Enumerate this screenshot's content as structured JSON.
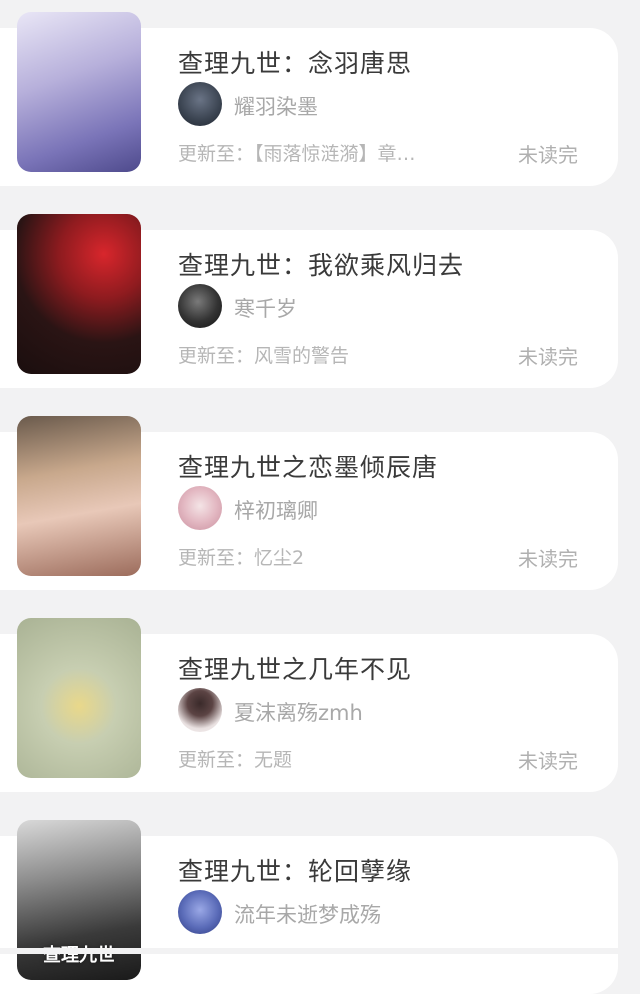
{
  "books": [
    {
      "title": "查理九世：念羽唐思",
      "author": "耀羽染墨",
      "update_prefix": "更新至：",
      "update": "【雨落惊涟漪】章…",
      "status": "未读完",
      "cover_text": "",
      "colors": {
        "cover": "#b9b3dc",
        "avatar": "#3a4350"
      }
    },
    {
      "title": "查理九世：我欲乘风归去",
      "author": "寒千岁",
      "update_prefix": "更新至：",
      "update": "风雪的警告",
      "status": "未读完",
      "cover_text": "",
      "colors": {
        "cover": "#3b1d1d",
        "avatar": "#2a2a2a"
      }
    },
    {
      "title": "查理九世之恋墨倾辰唐",
      "author": "梓初璃卿",
      "update_prefix": "更新至：",
      "update": "忆尘2",
      "status": "未读完",
      "cover_text": "",
      "colors": {
        "cover": "#c9a58f",
        "avatar": "#e6cdd3"
      }
    },
    {
      "title": "查理九世之几年不见",
      "author": "夏沫离殇zmh",
      "update_prefix": "更新至：",
      "update": "无题",
      "status": "未读完",
      "cover_text": "",
      "colors": {
        "cover": "#c7ceb1",
        "avatar": "#e9e1e1"
      }
    },
    {
      "title": "查理九世：轮回孽缘",
      "author": "流年未逝梦成殇",
      "update_prefix": "",
      "update": "",
      "status": "",
      "cover_text": "查理九世",
      "colors": {
        "cover": "#4c4c4c",
        "avatar": "#5a6bb8"
      }
    }
  ]
}
